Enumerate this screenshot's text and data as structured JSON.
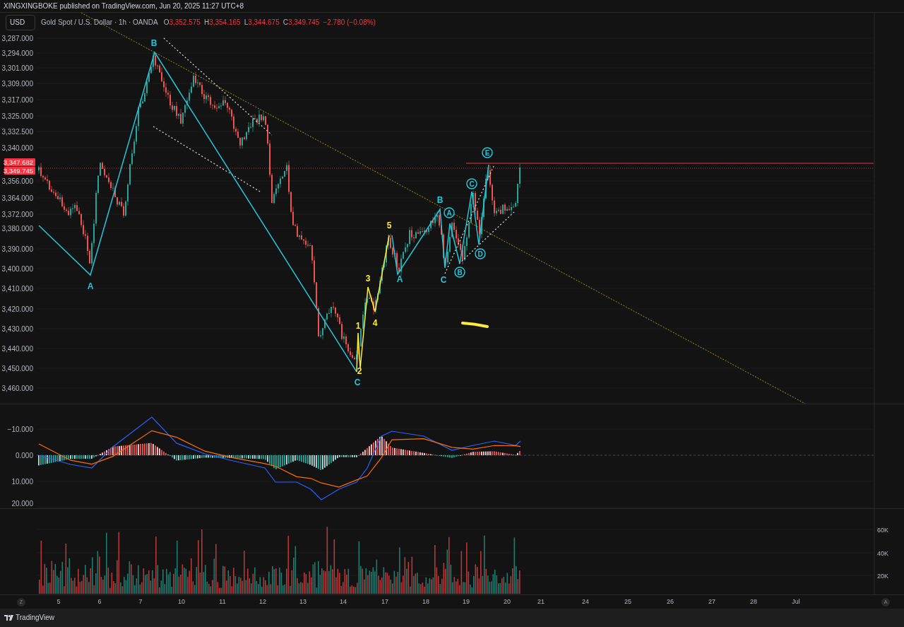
{
  "header": {
    "text": "XINGXINGBOKE published on TradingView.com, Jun 20, 2025 11:27 UTC+8"
  },
  "currency_button": "USD",
  "legend": {
    "symbol": "Gold Spot / U.S. Dollar · 1h · OANDA",
    "ohlc": [
      {
        "key": "O",
        "value": "3,352.575"
      },
      {
        "key": "H",
        "value": "3,354.165"
      },
      {
        "key": "L",
        "value": "3,344.675"
      },
      {
        "key": "C",
        "value": "3,349.745"
      }
    ],
    "change": "−2.780 (−0.08%)"
  },
  "price_axis": {
    "ticks": [
      "3,287.000",
      "3,294.000",
      "3,301.000",
      "3,309.000",
      "3,317.000",
      "3,325.000",
      "3,332.500",
      "3,340.000",
      "3,356.000",
      "3,364.000",
      "3,372.000",
      "3,380.000",
      "3,390.000",
      "3,400.000",
      "3,410.000",
      "3,420.000",
      "3,430.000",
      "3,440.000",
      "3,450.000",
      "3,460.000"
    ],
    "price_tags": [
      "3,347.682",
      "3,349.745"
    ]
  },
  "wave_labels": [
    {
      "text": "A",
      "kind": "plain",
      "color": "#26c6da"
    },
    {
      "text": "B",
      "kind": "plain",
      "color": "#26c6da"
    },
    {
      "text": "1",
      "kind": "plain",
      "color": "#ffeb3b"
    },
    {
      "text": "2",
      "kind": "plain",
      "color": "#ffeb3b"
    },
    {
      "text": "C",
      "kind": "plain",
      "color": "#26c6da"
    },
    {
      "text": "3",
      "kind": "plain",
      "color": "#ffeb3b"
    },
    {
      "text": "4",
      "kind": "plain",
      "color": "#ffeb3b"
    },
    {
      "text": "5",
      "kind": "plain",
      "color": "#ffeb3b"
    },
    {
      "text": "A",
      "kind": "plain",
      "color": "#26c6da"
    },
    {
      "text": "B",
      "kind": "plain",
      "color": "#26c6da"
    },
    {
      "text": "C",
      "kind": "plain",
      "color": "#26c6da"
    },
    {
      "text": "A",
      "kind": "circled",
      "color": "#26c6da"
    },
    {
      "text": "B",
      "kind": "circled",
      "color": "#26c6da"
    },
    {
      "text": "C",
      "kind": "circled",
      "color": "#26c6da"
    },
    {
      "text": "D",
      "kind": "circled",
      "color": "#26c6da"
    },
    {
      "text": "E",
      "kind": "circled",
      "color": "#26c6da"
    }
  ],
  "macd_axis": {
    "ticks": [
      "−10.000",
      "0.000",
      "10.000",
      "20.000"
    ]
  },
  "volume_axis": {
    "ticks": [
      "60K",
      "40K",
      "20K"
    ]
  },
  "time_axis": {
    "ticks": [
      "5",
      "6",
      "7",
      "10",
      "11",
      "12",
      "13",
      "14",
      "17",
      "18",
      "19",
      "20",
      "21",
      "24",
      "25",
      "26",
      "27",
      "28",
      "Jul"
    ]
  },
  "corner_buttons": [
    "Z",
    "A"
  ],
  "footer": {
    "brand": "TradingView"
  }
}
